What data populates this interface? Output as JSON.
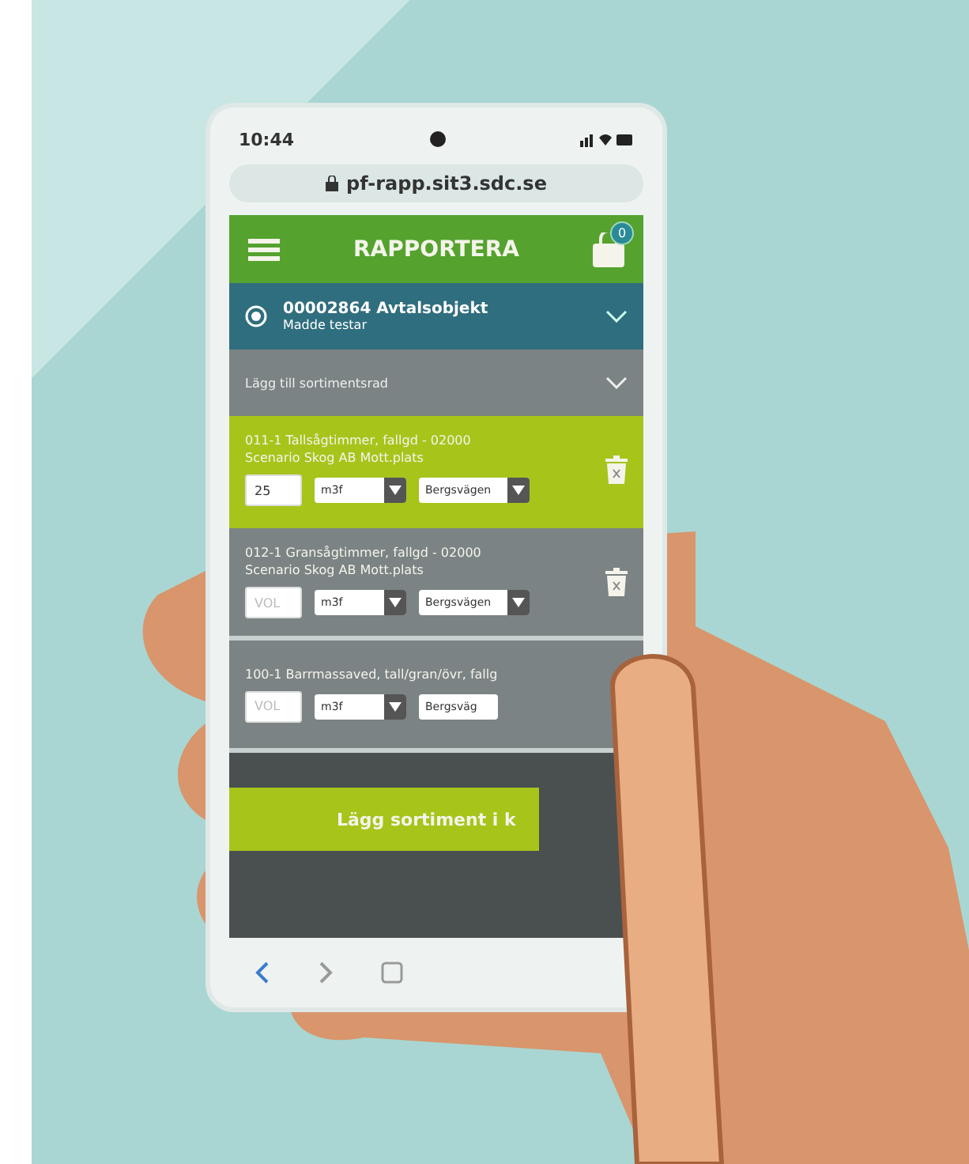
{
  "status_bar": {
    "time": "10:44"
  },
  "browser": {
    "url": "pf-rapp.sit3.sdc.se"
  },
  "header": {
    "title": "RAPPORTERA",
    "cart_count": "0"
  },
  "object": {
    "number_title": "00002864 Avtalsobjekt",
    "subtitle": "Madde testar",
    "selected": true
  },
  "add_row": {
    "label": "Lägg till sortimentsrad"
  },
  "items": [
    {
      "title": "011-1 Tallsågtimmer, fallgd - 02000",
      "place": "Scenario Skog AB Mott.plats",
      "selected": true,
      "volume": {
        "value": "25"
      },
      "unit": "m3f",
      "location": "Bergsvägen"
    },
    {
      "title": "012-1 Gransågtimmer, fallgd - 02000",
      "place": "Scenario Skog AB Mott.plats",
      "selected": false,
      "volume": {
        "placeholder": "VOL"
      },
      "unit": "m3f",
      "location": "Bergsvägen"
    },
    {
      "title": "100-1 Barrmassaved, tall/gran/övr, fallg",
      "selected": false,
      "volume": {
        "placeholder": "VOL"
      },
      "unit": "m3f",
      "location": "Bergsväg"
    }
  ],
  "submit": {
    "label": "Lägg sortiment i k"
  }
}
